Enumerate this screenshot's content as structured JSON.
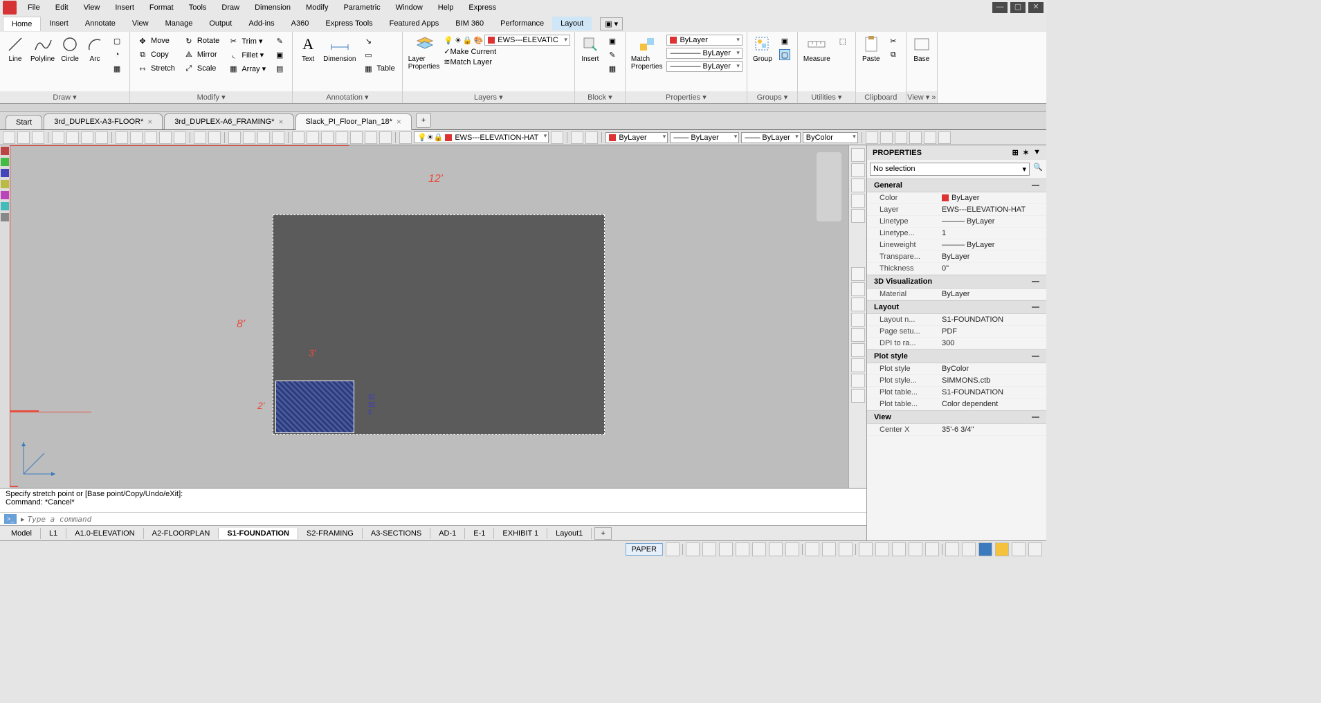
{
  "menubar": {
    "items": [
      "File",
      "Edit",
      "View",
      "Insert",
      "Format",
      "Tools",
      "Draw",
      "Dimension",
      "Modify",
      "Parametric",
      "Window",
      "Help",
      "Express"
    ]
  },
  "ribtabs": {
    "items": [
      "Home",
      "Insert",
      "Annotate",
      "View",
      "Manage",
      "Output",
      "Add-ins",
      "A360",
      "Express Tools",
      "Featured Apps",
      "BIM 360",
      "Performance",
      "Layout"
    ],
    "active": "Home",
    "highlight": "Layout"
  },
  "ribbon": {
    "draw": {
      "title": "Draw ▾",
      "line": "Line",
      "polyline": "Polyline",
      "circle": "Circle",
      "arc": "Arc"
    },
    "modify": {
      "title": "Modify ▾",
      "move": "Move",
      "copy": "Copy",
      "stretch": "Stretch",
      "rotate": "Rotate",
      "mirror": "Mirror",
      "scale": "Scale",
      "trim": "Trim ▾",
      "fillet": "Fillet ▾",
      "array": "Array ▾"
    },
    "annotation": {
      "title": "Annotation ▾",
      "text": "Text",
      "dimension": "Dimension",
      "table": "Table"
    },
    "layers": {
      "title": "Layers ▾",
      "layerprop": "Layer\nProperties",
      "makecurrent": "Make Current",
      "matchlayer": "Match Layer",
      "current": "EWS---ELEVATIC"
    },
    "block": {
      "title": "Block ▾",
      "insert": "Insert"
    },
    "properties": {
      "title": "Properties ▾",
      "matchprop": "Match\nProperties",
      "color": "ByLayer",
      "linetype": "ByLayer",
      "lineweight": "ByLayer"
    },
    "groups": {
      "title": "Groups ▾",
      "group": "Group"
    },
    "utilities": {
      "title": "Utilities ▾",
      "measure": "Measure"
    },
    "clipboard": {
      "title": "Clipboard",
      "paste": "Paste"
    },
    "view": {
      "title": "View ▾ »",
      "base": "Base"
    }
  },
  "doctabs": {
    "items": [
      {
        "label": "Start",
        "closable": false
      },
      {
        "label": "3rd_DUPLEX-A3-FLOOR*",
        "closable": true
      },
      {
        "label": "3rd_DUPLEX-A6_FRAMING*",
        "closable": true
      },
      {
        "label": "Slack_PI_Floor_Plan_18*",
        "closable": true,
        "active": true
      }
    ]
  },
  "quickbar": {
    "layer": "EWS---ELEVATION-HAT",
    "color": "ByLayer",
    "linetype": "ByLayer",
    "lineweight": "ByLayer",
    "plotstyle": "ByColor"
  },
  "dimensions": {
    "top": "12'",
    "left": "8'",
    "small_w": "3'",
    "small_h": "2'"
  },
  "properties": {
    "title": "PROPERTIES",
    "selection": "No selection",
    "sections": [
      {
        "name": "General",
        "rows": [
          {
            "k": "Color",
            "v": "ByLayer",
            "swatch": "#d33"
          },
          {
            "k": "Layer",
            "v": "EWS---ELEVATION-HAT"
          },
          {
            "k": "Linetype",
            "v": "——— ByLayer"
          },
          {
            "k": "Linetype...",
            "v": "1"
          },
          {
            "k": "Lineweight",
            "v": "——— ByLayer"
          },
          {
            "k": "Transpare...",
            "v": "ByLayer"
          },
          {
            "k": "Thickness",
            "v": "0\""
          }
        ]
      },
      {
        "name": "3D Visualization",
        "rows": [
          {
            "k": "Material",
            "v": "ByLayer"
          }
        ]
      },
      {
        "name": "Layout",
        "rows": [
          {
            "k": "Layout n...",
            "v": "S1-FOUNDATION"
          },
          {
            "k": "Page setu...",
            "v": "PDF"
          },
          {
            "k": "DPI to ra...",
            "v": "300"
          }
        ]
      },
      {
        "name": "Plot style",
        "rows": [
          {
            "k": "Plot style",
            "v": "ByColor"
          },
          {
            "k": "Plot style...",
            "v": "SIMMONS.ctb"
          },
          {
            "k": "Plot table...",
            "v": "S1-FOUNDATION"
          },
          {
            "k": "Plot table...",
            "v": "Color dependent"
          }
        ]
      },
      {
        "name": "View",
        "rows": [
          {
            "k": "Center X",
            "v": "35'-6 3/4\""
          }
        ]
      }
    ]
  },
  "command": {
    "hist1": "Specify stretch point or [Base point/Copy/Undo/eXit]:",
    "hist2": "Command: *Cancel*",
    "placeholder": "Type a command"
  },
  "layouttabs": {
    "items": [
      "Model",
      "L1",
      "A1.0-ELEVATION",
      "A2-FLOORPLAN",
      "S1-FOUNDATION",
      "S2-FRAMING",
      "A3-SECTIONS",
      "AD-1",
      "E-1",
      "EXHIBIT 1",
      "Layout1"
    ],
    "active": "S1-FOUNDATION"
  },
  "statusbar": {
    "paper": "PAPER"
  }
}
